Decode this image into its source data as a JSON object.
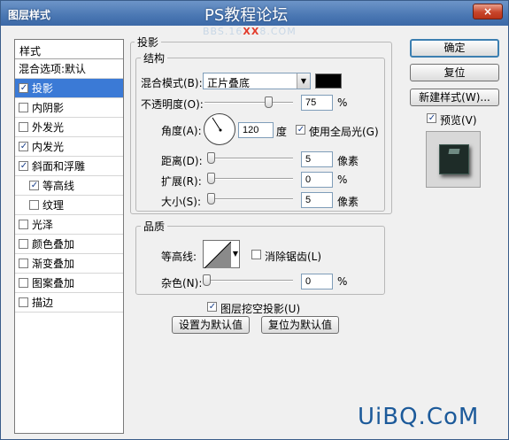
{
  "window": {
    "title": "图层样式",
    "watermark_title": "PS教程论坛",
    "watermark_url_pre": "BBS.16",
    "watermark_url_mid": "XX",
    "watermark_url_post": "8.COM",
    "close_label": "×"
  },
  "stylelist": {
    "header": "样式",
    "items": [
      {
        "label": "混合选项:默认",
        "has_checkbox": false,
        "checked": false,
        "selected": false,
        "indent": false
      },
      {
        "label": "投影",
        "has_checkbox": true,
        "checked": true,
        "selected": true,
        "indent": false
      },
      {
        "label": "内阴影",
        "has_checkbox": true,
        "checked": false,
        "selected": false,
        "indent": false
      },
      {
        "label": "外发光",
        "has_checkbox": true,
        "checked": false,
        "selected": false,
        "indent": false
      },
      {
        "label": "内发光",
        "has_checkbox": true,
        "checked": true,
        "selected": false,
        "indent": false
      },
      {
        "label": "斜面和浮雕",
        "has_checkbox": true,
        "checked": true,
        "selected": false,
        "indent": false
      },
      {
        "label": "等高线",
        "has_checkbox": true,
        "checked": true,
        "selected": false,
        "indent": true
      },
      {
        "label": "纹理",
        "has_checkbox": true,
        "checked": false,
        "selected": false,
        "indent": true
      },
      {
        "label": "光泽",
        "has_checkbox": true,
        "checked": false,
        "selected": false,
        "indent": false
      },
      {
        "label": "颜色叠加",
        "has_checkbox": true,
        "checked": false,
        "selected": false,
        "indent": false
      },
      {
        "label": "渐变叠加",
        "has_checkbox": true,
        "checked": false,
        "selected": false,
        "indent": false
      },
      {
        "label": "图案叠加",
        "has_checkbox": true,
        "checked": false,
        "selected": false,
        "indent": false
      },
      {
        "label": "描边",
        "has_checkbox": true,
        "checked": false,
        "selected": false,
        "indent": false
      }
    ]
  },
  "shadow": {
    "group_label": "投影",
    "structure_label": "结构",
    "blend_mode_label": "混合模式(B):",
    "blend_mode_value": "正片叠底",
    "blend_color": "#000000",
    "opacity_label": "不透明度(O):",
    "opacity_value": "75",
    "opacity_unit": "%",
    "opacity_level": 0.75,
    "angle_label": "角度(A):",
    "angle_value": "120",
    "angle_unit": "度",
    "global_light_label": "使用全局光(G)",
    "global_light_checked": true,
    "distance_label": "距离(D):",
    "distance_value": "5",
    "distance_unit": "像素",
    "spread_label": "扩展(R):",
    "spread_value": "0",
    "spread_unit": "%",
    "size_label": "大小(S):",
    "size_value": "5",
    "size_unit": "像素"
  },
  "quality": {
    "group_label": "品质",
    "contour_label": "等高线:",
    "antialias_label": "消除锯齿(L)",
    "antialias_checked": false,
    "noise_label": "杂色(N):",
    "noise_value": "0",
    "noise_unit": "%"
  },
  "layer_knockout": {
    "label": "图层挖空投影(U)",
    "checked": true
  },
  "buttons": {
    "make_default": "设置为默认值",
    "reset_default": "复位为默认值",
    "ok": "确定",
    "reset": "复位",
    "new_style": "新建样式(W)...",
    "preview_label": "预览(V)",
    "preview_checked": true
  },
  "footer_watermark": "UiBQ.CoM"
}
